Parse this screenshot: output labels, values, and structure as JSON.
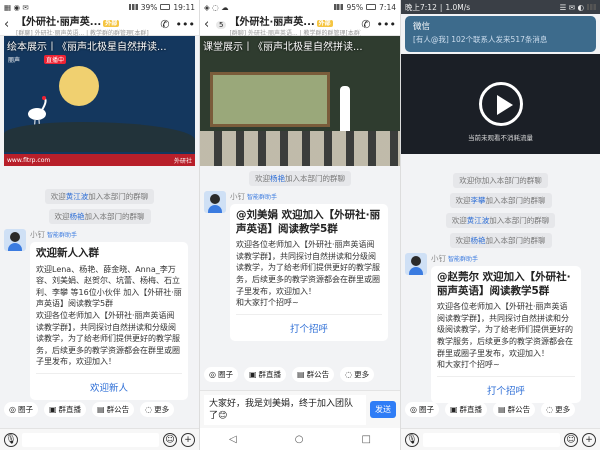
{
  "panel1": {
    "status": {
      "time": "19:11",
      "battery": "39%",
      "icons": "▦ ◉ ✉"
    },
    "title": "【外研社·丽声英...",
    "subtitle": "[群聊] 外研社·丽声英语... | 教学群的群管理[本群]",
    "ext_tag": "外部",
    "video": {
      "title": "绘本展示丨《丽声北极星自然拼读...",
      "host": "丽声",
      "live": "直播中",
      "footer_left": "www.fltrp.com",
      "footer_right": "外研社"
    },
    "system_msgs": [
      {
        "name": "黄江波",
        "text": "加入本部门的群聊"
      },
      {
        "name": "杨艳",
        "text": "加入本部门的群聊"
      }
    ],
    "sender": "小钉",
    "bot_tag": "智能群助手",
    "card": {
      "title": "欢迎新人入群",
      "body": "欢迎Lena、杨艳、薛金晓、Anna_李万容、刘美娟、赵贺尔、坑蕾、杨梅、石立利、李攀 等16位小伙伴 加入【外研社·丽声英语】阅读教学5群\n欢迎各位老师加入【外研社·丽声英语阅读教学群】，共同探讨自然拼读和分级阅读教学，为了给老师们提供更好的教学服务，后续更多的教学资源都会在群里或圈子里发布，欢迎加入！",
      "button": "欢迎新人"
    },
    "toolbar": [
      "圈子",
      "群直播",
      "群公告",
      "更多"
    ]
  },
  "panel2": {
    "status": {
      "time": "7:14",
      "battery": "95%",
      "icons": "◈ ◌ ☁"
    },
    "back_count": "5",
    "title": "【外研社·丽声英...",
    "subtitle": "[群聊] 外研社·丽声英语... | 教学群的群管理[本群]",
    "ext_tag": "外部",
    "video": {
      "title": "课堂展示丨《丽声北极星自然拼读..."
    },
    "system_msgs": [
      {
        "name": "杨艳",
        "text": "加入本部门的群聊"
      }
    ],
    "sender": "小钉",
    "bot_tag": "智能群助手",
    "card": {
      "title": "@刘美娟  欢迎加入【外研社·丽声英语】阅读教学5群",
      "body": "欢迎各位老师加入【外研社·丽声英语阅读教学群】，共同探讨自然拼读和分级阅读教学，为了给老师们提供更好的教学服务，后续更多的教学资源都会在群里或圈子里发布，欢迎加入！\n和大家打个招呼~",
      "button": "打个招呼"
    },
    "toolbar": [
      "圈子",
      "群直播",
      "群公告",
      "更多"
    ],
    "compose_text": "大家好，我是刘美娟，终于加入团队了😊",
    "send": "发送",
    "nav": [
      "◁",
      "○",
      "□"
    ]
  },
  "panel3": {
    "status": {
      "time": "晚上7:12",
      "speed": "1.0M/s",
      "icons": "☰ ✉ ◐"
    },
    "popup": {
      "title": "微信",
      "text": "[有人@我] 102个联系人发来517条消息"
    },
    "video": {
      "caption": "当前未观看不消耗流量"
    },
    "system_msgs": [
      {
        "name": "",
        "text": "欢迎你加入本部门的群聊"
      },
      {
        "name": "李攀",
        "text": "加入本部门的群聊"
      },
      {
        "name": "黄江波",
        "text": "加入本部门的群聊"
      },
      {
        "name": "杨艳",
        "text": "加入本部门的群聊"
      }
    ],
    "sender": "小钉",
    "bot_tag": "智能群助手",
    "card": {
      "title": "@赵莞尔  欢迎加入【外研社·丽声英语】阅读教学5群",
      "body": "欢迎各位老师加入【外研社·丽声英语阅读教学群】，共同探讨自然拼读和分级阅读教学，为了给老师们提供更好的教学服务，后续更多的教学资源都会在群里或圈子里发布，欢迎加入！\n和大家打个招呼~",
      "button": "打个招呼"
    },
    "toolbar": [
      "圈子",
      "群直播",
      "群公告",
      "更多"
    ]
  },
  "toolbar_icons": [
    "◎",
    "▣",
    "▤",
    "◌"
  ]
}
